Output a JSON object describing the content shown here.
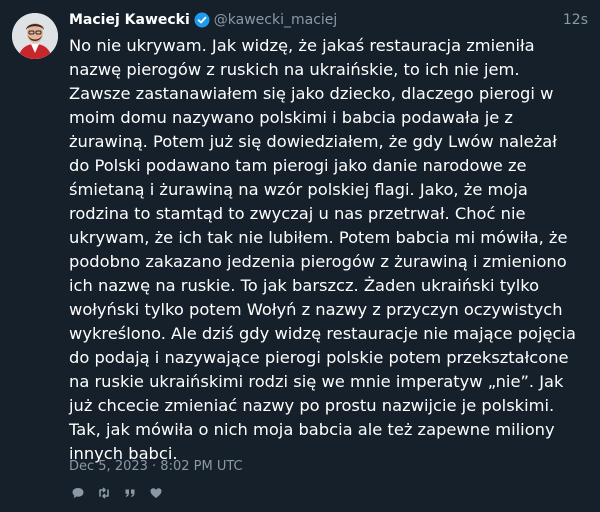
{
  "author": {
    "name": "Maciej Kawecki",
    "handle": "@kawecki_maciej",
    "verified_icon": "verified-badge-icon",
    "avatar_icon": "avatar-icon"
  },
  "relative_time": "12s",
  "tweet_lines": [
    "No nie ukrywam. Jak widzę, że jakaś restauracja zmieniła",
    "nazwę pierogów z ruskich na ukraińskie, to ich nie jem.",
    "Zawsze zastanawiałem się jako dziecko, dlaczego pierogi w",
    "moim domu nazywano polskimi i babcia podawała je z",
    "żurawiną. Potem już się dowiedziałem, że gdy Lwów należał",
    "do Polski podawano tam pierogi jako danie narodowe ze",
    "śmietaną i żurawiną na wzór polskiej flagi. Jako, że moja",
    "rodzina to stamtąd to zwyczaj u nas przetrwał. Choć nie",
    "ukrywam, że ich tak nie lubiłem. Potem babcia mi mówiła, że",
    "podobno zakazano jedzenia pierogów z żurawiną i zmieniono",
    "ich nazwę na ruskie. To jak barszcz. Żaden ukraiński tylko",
    "wołyński tylko potem Wołyń z nazwy z przyczyn oczywistych",
    "wykreślono. Ale dziś gdy widzę restauracje nie mające pojęcia",
    "do podają i nazywające pierogi polskie potem przekształcone",
    "na ruskie ukraińskimi rodzi się we mnie imperatyw „nie”. Jak",
    "już chcecie zmieniać nazwy po prostu nazwijcie je polskimi.",
    "Tak, jak mówiła o nich moja babcia ale też zapewne miliony",
    "innych babci."
  ],
  "timestamp": "Dec 5, 2023 · 8:02 PM UTC",
  "actions": [
    {
      "icon": "reply-icon"
    },
    {
      "icon": "retweet-icon"
    },
    {
      "icon": "quote-icon"
    },
    {
      "icon": "like-icon"
    }
  ],
  "colors": {
    "background": "#15202b",
    "text": "#ffffff",
    "muted": "#8b98a5",
    "verified": "#1d9bf0"
  }
}
